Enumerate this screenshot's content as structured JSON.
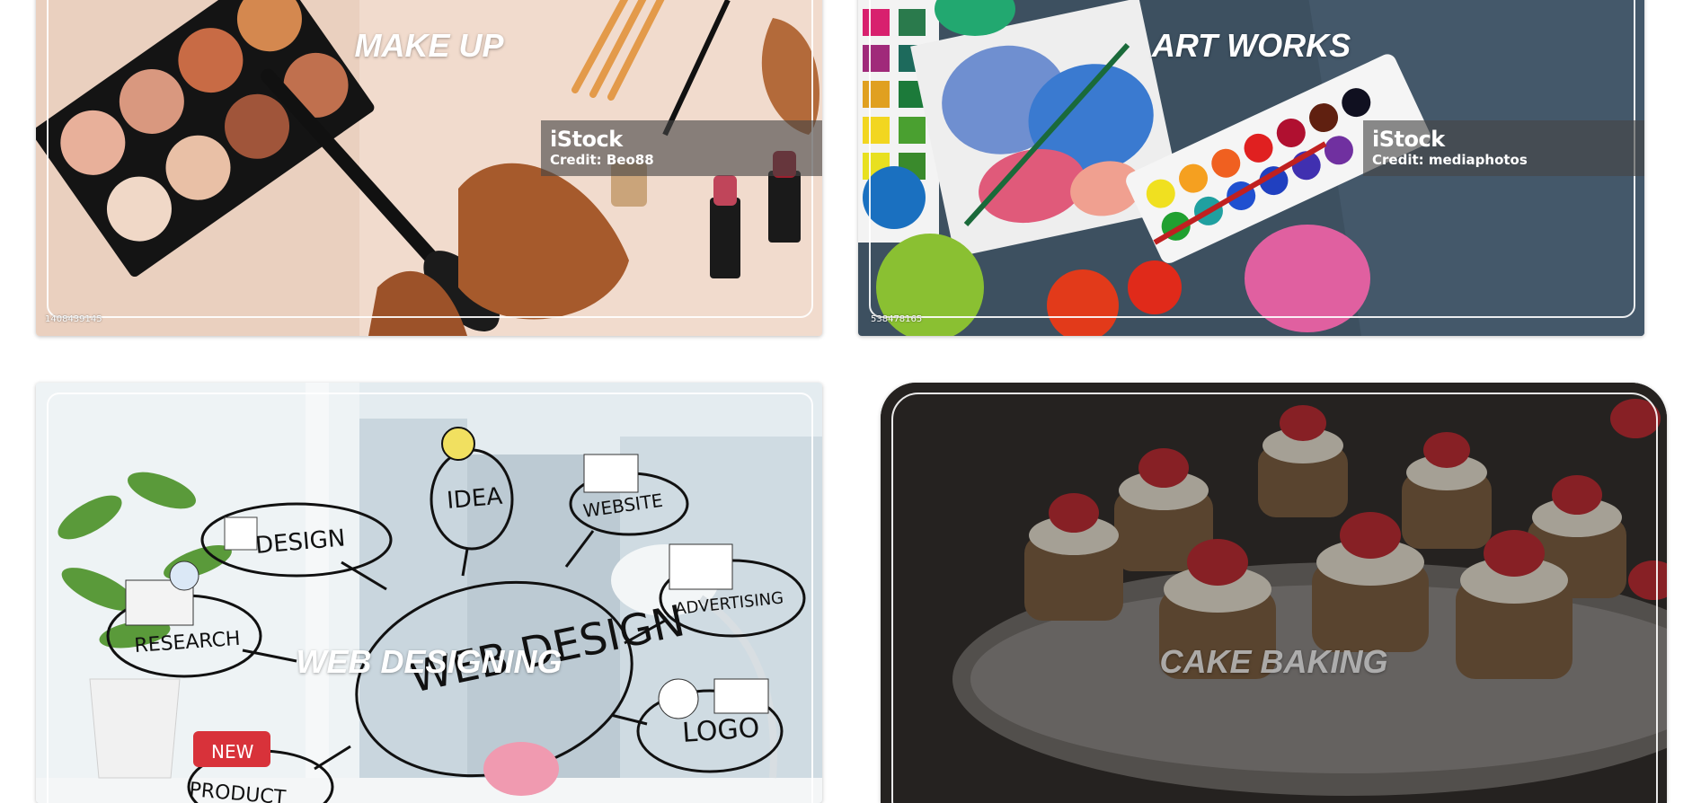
{
  "cards": [
    {
      "title": "MAKE UP",
      "istock_brand": "iStock",
      "istock_credit": "Credit: Beo88",
      "asset_id": "1408439145",
      "theme": "#e6c2aa"
    },
    {
      "title": "ART WORKS",
      "istock_brand": "iStock",
      "istock_credit": "Credit: mediaphotos",
      "asset_id": "538478165",
      "theme": "#3e5365"
    },
    {
      "title": "WEB DESIGNING",
      "theme": "#dfe9ee",
      "sketch_labels": [
        "DESIGN",
        "IDEA",
        "WEBSITE",
        "ADVERTISING",
        "RESEARCH",
        "WEB DESIGN",
        "LOGO",
        "NEW",
        "PRODUCT"
      ]
    },
    {
      "title": "CAKE BAKING",
      "theme": "#2a2623"
    }
  ]
}
